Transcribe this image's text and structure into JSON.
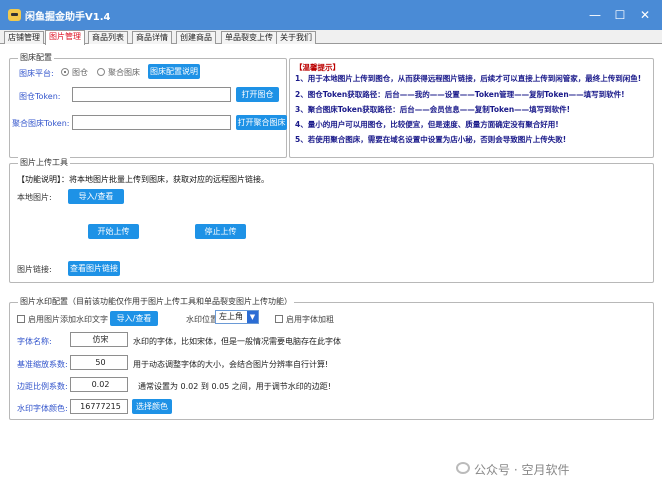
{
  "window": {
    "title": "闲鱼掘金助手V1.4",
    "min": "—",
    "max": "☐",
    "close": "✕"
  },
  "tabs": [
    {
      "label": "店铺管理"
    },
    {
      "label": "图片管理"
    },
    {
      "label": "商品列表"
    },
    {
      "label": "商品详情"
    },
    {
      "label": "创建商品"
    },
    {
      "label": "单品裂变上传"
    },
    {
      "label": "关于我们"
    }
  ],
  "bed": {
    "title": "图床配置",
    "platform_label": "图床平台:",
    "opt1": "图仓",
    "opt2": "聚合图床",
    "doc_btn": "图床配置说明",
    "token1_label": "图仓Token:",
    "token1_value": "",
    "open1_btn": "打开图仓",
    "token2_label": "聚合图床Token:",
    "token2_value": "",
    "open2_btn": "打开聚合图床"
  },
  "tips": {
    "title": "【温馨提示】",
    "t1": "1、用于本地图片上传到图仓，从而获得远程图片链接，后续才可以直接上传到闲管家，最终上传到闲鱼!",
    "t2": "2、图仓Token获取路径：后台——我的——设置——Token管理——复制Token——填写到软件!",
    "t3": "3、聚合图床Token获取路径：后台——会员信息——复制Token——填写到软件!",
    "t4": "4、量小的用户可以用图仓，比较便宜，但是速度、质量方面确定没有聚合好用!",
    "t5": "5、若使用聚合图床，需要在域名设置中设置为店小秘，否则会导致图片上传失败!"
  },
  "upload": {
    "title": "图片上传工具",
    "desc": "【功能说明】：将本地图片批量上传到图床，获取对应的远程图片链接。",
    "local_label": "本地图片:",
    "import_btn": "导入/查看",
    "start_btn": "开始上传",
    "stop_btn": "停止上传",
    "link_label": "图片链接:",
    "view_btn": "查看图片链接"
  },
  "wm": {
    "title": "图片水印配置（目前该功能仅作用于图片上传工具和单品裂变图片上传功能）",
    "enable_text": "启用图片添加水印文字",
    "import_btn": "导入/查看",
    "pos_label": "水印位置:",
    "pos_value": "左上角",
    "bold_label": "启用字体加粗",
    "font_label": "字体名称:",
    "font_value": "仿宋",
    "font_desc": "水印的字体，比如宋体，但是一般情况需要电脑存在此字体",
    "scale_label": "基准缩放系数:",
    "scale_value": "50",
    "scale_desc": "用于动态调整字体的大小，会结合图片分辨率自行计算!",
    "margin_label": "边距比例系数:",
    "margin_value": "0.02",
    "margin_desc": "通常设置为 0.02 到 0.05 之间，用于调节水印的边距!",
    "color_label": "水印字体颜色:",
    "color_value": "16777215",
    "color_btn": "选择颜色"
  },
  "watermark_text": "公众号 · 空月软件",
  "colors": {
    "accent": "#1e92e6",
    "titlebar": "#4a8bd6",
    "label": "#3355cc"
  }
}
